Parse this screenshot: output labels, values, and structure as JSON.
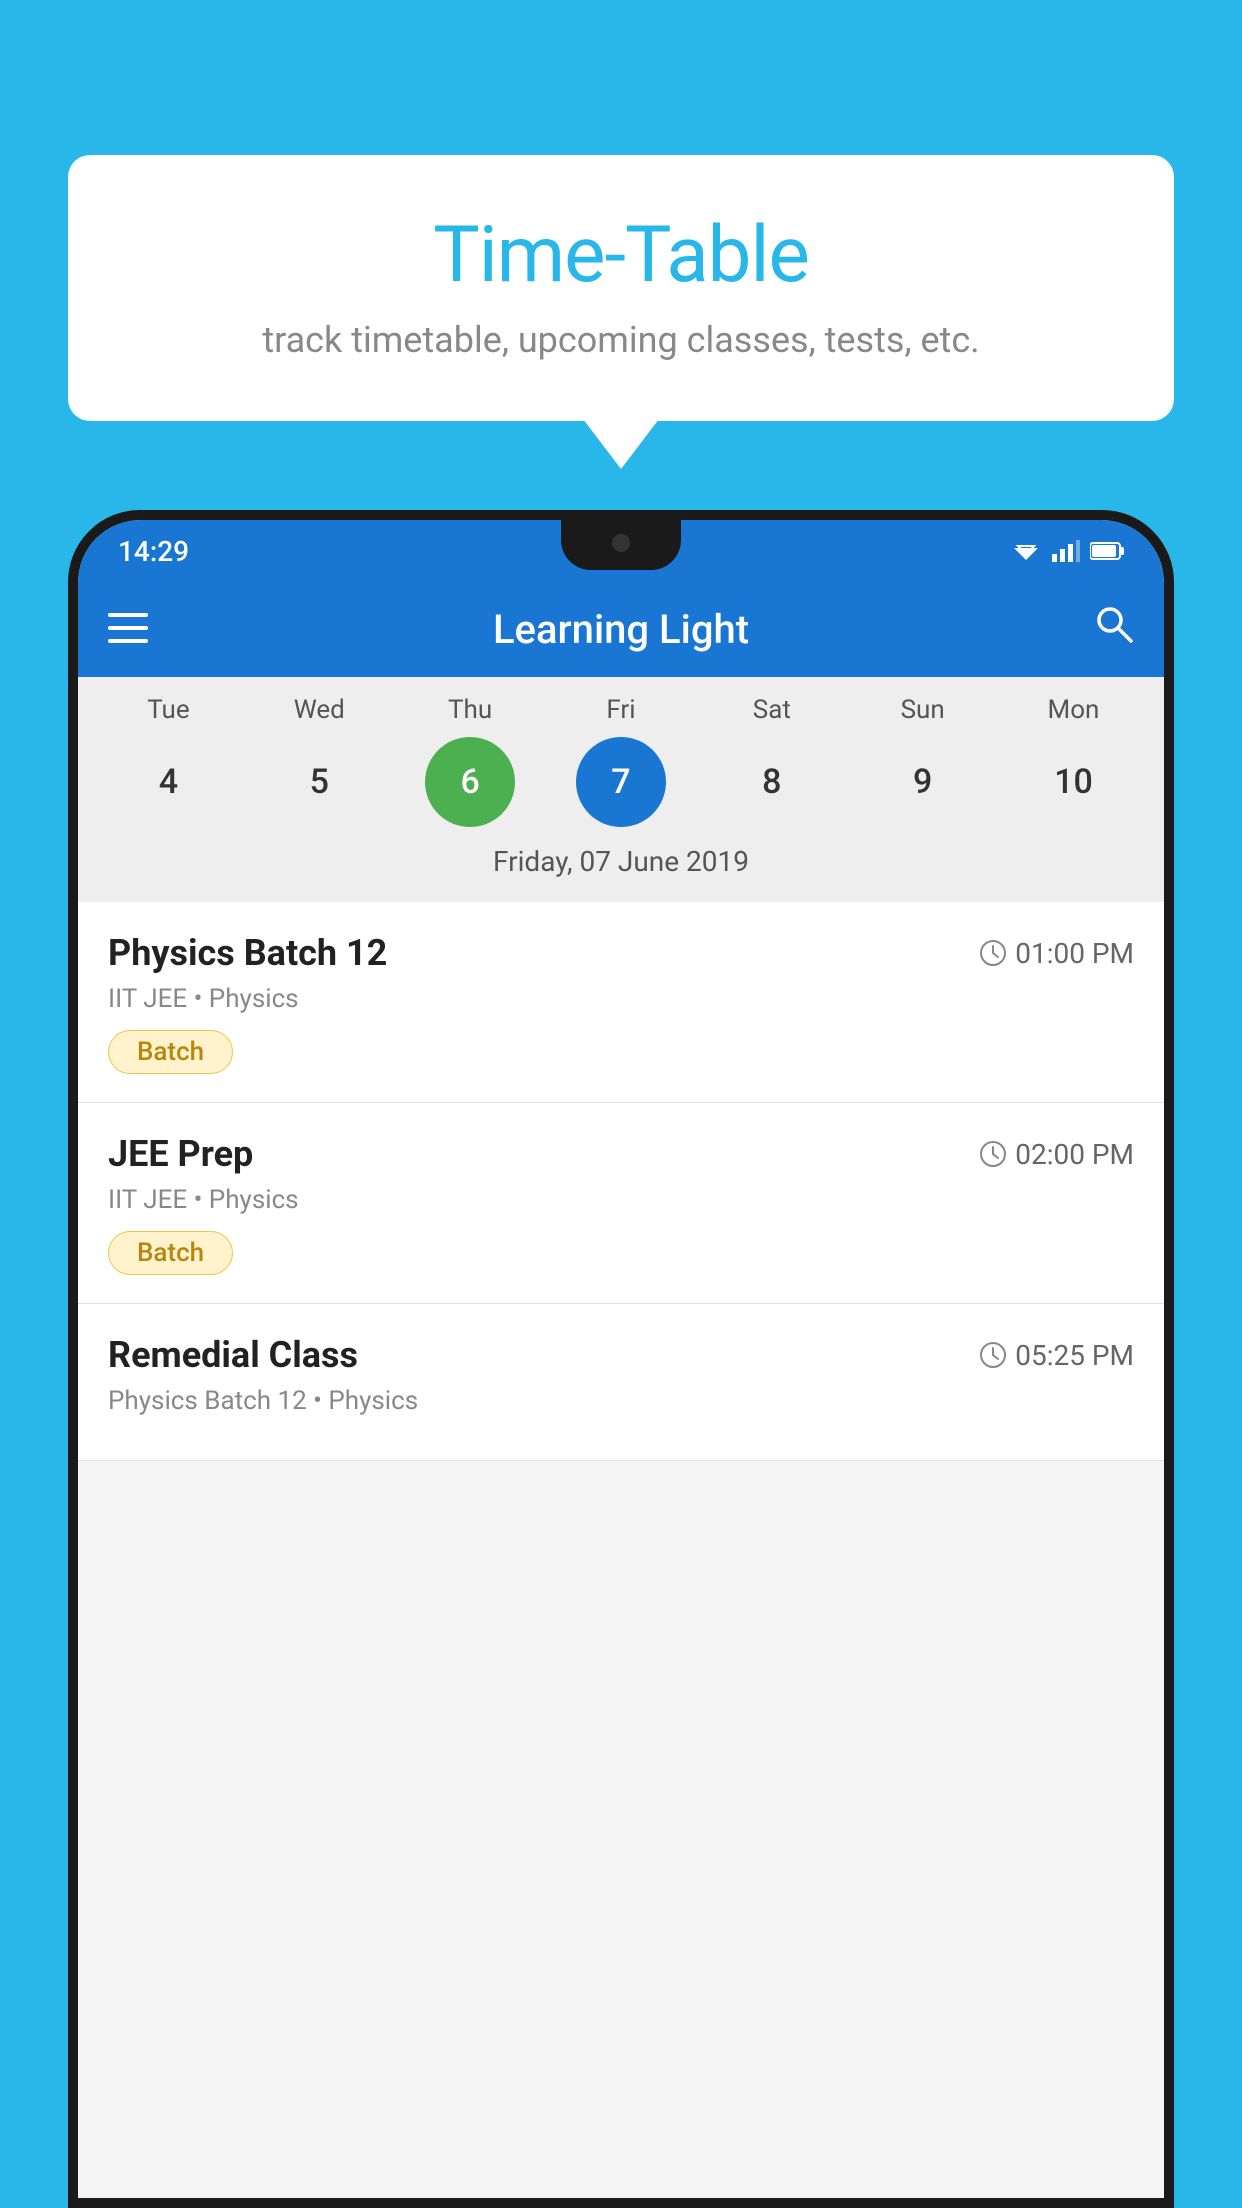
{
  "page": {
    "background_color": "#29b6e8"
  },
  "speech_bubble": {
    "title": "Time-Table",
    "subtitle": "track timetable, upcoming classes, tests, etc."
  },
  "app": {
    "name": "Learning Light",
    "status_bar": {
      "time": "14:29",
      "icons": [
        "wifi",
        "signal",
        "battery"
      ]
    }
  },
  "calendar": {
    "selected_date_label": "Friday, 07 June 2019",
    "days": [
      "Tue",
      "Wed",
      "Thu",
      "Fri",
      "Sat",
      "Sun",
      "Mon"
    ],
    "dates": [
      {
        "number": "4",
        "state": "normal"
      },
      {
        "number": "5",
        "state": "normal"
      },
      {
        "number": "6",
        "state": "today"
      },
      {
        "number": "7",
        "state": "selected"
      },
      {
        "number": "8",
        "state": "normal"
      },
      {
        "number": "9",
        "state": "normal"
      },
      {
        "number": "10",
        "state": "normal"
      }
    ]
  },
  "classes": [
    {
      "name": "Physics Batch 12",
      "time": "01:00 PM",
      "meta": "IIT JEE • Physics",
      "tag": "Batch"
    },
    {
      "name": "JEE Prep",
      "time": "02:00 PM",
      "meta": "IIT JEE • Physics",
      "tag": "Batch"
    },
    {
      "name": "Remedial Class",
      "time": "05:25 PM",
      "meta": "Physics Batch 12 • Physics",
      "tag": ""
    }
  ],
  "icons": {
    "hamburger": "≡",
    "search": "🔍",
    "clock": "🕐"
  }
}
